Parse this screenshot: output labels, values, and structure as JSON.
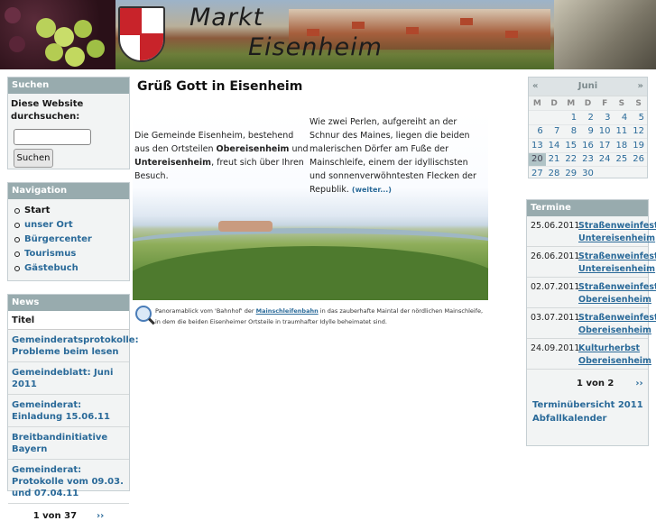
{
  "banner": {
    "title_line1": "Markt",
    "title_line2": "Eisenheim"
  },
  "search": {
    "header": "Suchen",
    "label": "Diese Website durchsuchen:",
    "input_value": "",
    "button": "Suchen"
  },
  "navigation": {
    "header": "Navigation",
    "items": [
      {
        "label": "Start",
        "current": true
      },
      {
        "label": "unser Ort",
        "current": false
      },
      {
        "label": "Bürgercenter",
        "current": false
      },
      {
        "label": "Tourismus",
        "current": false
      },
      {
        "label": "Gästebuch",
        "current": false
      }
    ]
  },
  "news": {
    "header": "News",
    "column_title": "Titel",
    "items": [
      "Gemeinderatsprotokolle: Probleme beim lesen",
      "Gemeindeblatt: Juni 2011",
      "Gemeinderat: Einladung 15.06.11",
      "Breitbandinitiative Bayern",
      "Gemeinderat: Protokolle vom 09.03. und 07.04.11"
    ],
    "pager": "1 von 37",
    "next": "››"
  },
  "main": {
    "heading": "Grüß Gott in Eisenheim",
    "intro_a": "Die Gemeinde Eisenheim, bestehend aus den Ortsteilen ",
    "intro_b": "Obereisenheim",
    "intro_c": " und ",
    "intro_d": "Untereisenheim",
    "intro_e": ", freut sich über Ihren Besuch.",
    "second": "Wie zwei Perlen, aufgereiht an der Schnur des Maines, liegen die beiden malerischen Dörfer am Fuße der Mainschleife, einem der idyllischsten und sonnenverwöhntesten Flecken der Republik. ",
    "more_link": "(weiter...)",
    "caption_a": "Panoramablick vom 'Bahnhof' der ",
    "caption_link": "Mainschleifenbahn",
    "caption_b": " in das zauberhafte Maintal der nördlichen Mainschleife, in dem die beiden Eisenheimer Ortsteile in traumhafter Idylle beheimatet sind."
  },
  "calendar": {
    "prev": "«",
    "month": "Juni",
    "next": "»",
    "weekdays": [
      "M",
      "D",
      "M",
      "D",
      "F",
      "S",
      "S"
    ],
    "weeks": [
      [
        "",
        "",
        "1",
        "2",
        "3",
        "4",
        "5"
      ],
      [
        "6",
        "7",
        "8",
        "9",
        "10",
        "11",
        "12"
      ],
      [
        "13",
        "14",
        "15",
        "16",
        "17",
        "18",
        "19"
      ],
      [
        "20",
        "21",
        "22",
        "23",
        "24",
        "25",
        "26"
      ],
      [
        "27",
        "28",
        "29",
        "30",
        "",
        "",
        ""
      ]
    ],
    "today": "20"
  },
  "termine": {
    "header": "Termine",
    "items": [
      {
        "date": "25.06.2011",
        "event": "Straßenweinfest Untereisenheim"
      },
      {
        "date": "26.06.2011",
        "event": "Straßenweinfest Untereisenheim"
      },
      {
        "date": "02.07.2011",
        "event": "Straßenweinfest Obereisenheim"
      },
      {
        "date": "03.07.2011",
        "event": "Straßenweinfest Obereisenheim"
      },
      {
        "date": "24.09.2011",
        "event": "Kulturherbst Obereisenheim"
      }
    ],
    "pager": "1 von 2",
    "next": "››",
    "overview": "Terminübersicht 2011",
    "abfall": "Abfallkalender"
  }
}
